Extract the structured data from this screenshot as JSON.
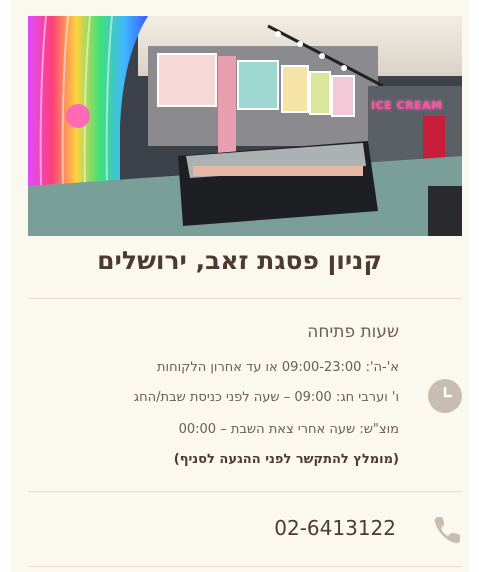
{
  "branch": {
    "image_alt": "Ice cream shop interior",
    "sign_text": "ICE CREAM",
    "title": "קניון פסגת זאב, ירושלים"
  },
  "hours": {
    "heading": "שעות פתיחה",
    "lines": [
      "א'-ה': 09:00-23:00 או עד אחרון הלקוחות",
      "ו' וערבי חג: 09:00 – שעה לפני כניסת שבת/החג",
      "מוצ\"ש: שעה אחרי צאת השבת – 00:00"
    ],
    "note": "(מומלץ להתקשר לפני ההגעה לסניף)",
    "icon": "clock-icon"
  },
  "contact": {
    "phone": "02-6413122",
    "icon": "phone-icon"
  },
  "colors": {
    "background": "#fbf8f0",
    "title": "#4e3b30",
    "text": "#6b5d55",
    "icon": "#c9bcb0"
  }
}
